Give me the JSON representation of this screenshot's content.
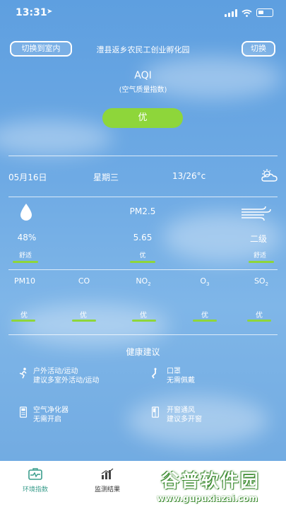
{
  "status": {
    "time": "13:31"
  },
  "header": {
    "switch_indoor": "切换到室内",
    "location": "澧县返乡农民工创业孵化园",
    "switch": "切换"
  },
  "aqi": {
    "title": "AQI",
    "subtitle": "(空气质量指数)",
    "level": "优"
  },
  "weather": {
    "date": "05月16日",
    "weekday": "星期三",
    "temp": "13/26°c",
    "icon": "partly-cloudy-icon"
  },
  "metrics": {
    "center_label": "PM2.5",
    "humidity": {
      "value": "48%",
      "tag": "舒适",
      "icon": "water-drop-icon"
    },
    "pm25": {
      "value": "5.65",
      "tag": "优"
    },
    "wind": {
      "value": "二级",
      "tag": "舒适",
      "icon": "wind-icon"
    }
  },
  "pollutants": [
    {
      "name": "PM10",
      "sub": "",
      "tag": "优"
    },
    {
      "name": "CO",
      "sub": "",
      "tag": "优"
    },
    {
      "name": "NO",
      "sub": "2",
      "tag": "优"
    },
    {
      "name": "O",
      "sub": "3",
      "tag": "优"
    },
    {
      "name": "SO",
      "sub": "2",
      "tag": "优"
    }
  ],
  "health": {
    "title": "健康建议",
    "items": [
      {
        "label": "户外活动/运动",
        "advice": "建议多室外活动/运动",
        "icon": "running-icon"
      },
      {
        "label": "口罩",
        "advice": "无需佩戴",
        "icon": "mask-icon"
      },
      {
        "label": "空气净化器",
        "advice": "无需开启",
        "icon": "air-purifier-icon"
      },
      {
        "label": "开窗通风",
        "advice": "建议多开窗",
        "icon": "window-icon"
      }
    ]
  },
  "tabbar": {
    "tabs": [
      {
        "label": "环境指数",
        "icon": "env-index-icon"
      },
      {
        "label": "监测结果",
        "icon": "bar-chart-icon"
      }
    ]
  },
  "watermark": {
    "text1": "谷普软件园",
    "text2": "www.gupuxiazai.com"
  },
  "colors": {
    "accent_green": "#8ed63a",
    "tab_active": "#3a9d8c"
  }
}
